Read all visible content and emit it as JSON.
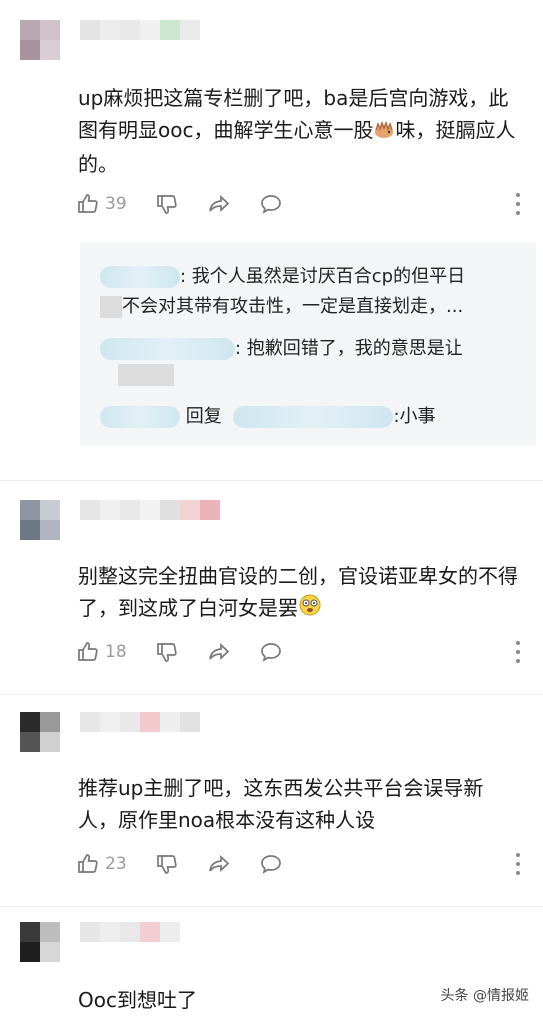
{
  "comments": [
    {
      "text_parts": [
        "up麻烦把这篇专栏删了吧，ba是后宫向游戏，此图有明显ooc，曲解学生心意一股",
        "味，挺膈应人的。"
      ],
      "emoji": "hedgehog",
      "likes": "39"
    },
    {
      "text_parts": [
        "别整这完全扭曲官设的二创，官设诺亚卑女的不得了，到这成了白河女是罢"
      ],
      "emoji": "dizzy-face",
      "likes": "18"
    },
    {
      "text": "推荐up主删了吧，这东西发公共平台会误导新人，原作里noa根本没有这种人设",
      "likes": "23"
    },
    {
      "text": "Ooc到想吐了"
    }
  ],
  "replies": [
    {
      "text": ": 我个人虽然是讨厌百合cp的但平日"
    },
    {
      "text": "不会对其带有攻击性，一定是直接划走，..."
    },
    {
      "text": ": 抱歉回错了，我的意思是让"
    },
    {
      "reply_label": "回复",
      "text": ":小事"
    }
  ],
  "watermark": "头条 @情报姬",
  "colors": {
    "meta_gray": "#9a9a9a",
    "reply_bg": "#f4f5f7",
    "divider": "#ececec"
  },
  "icons": [
    "like-icon",
    "dislike-icon",
    "share-icon",
    "reply-icon",
    "more-icon"
  ]
}
